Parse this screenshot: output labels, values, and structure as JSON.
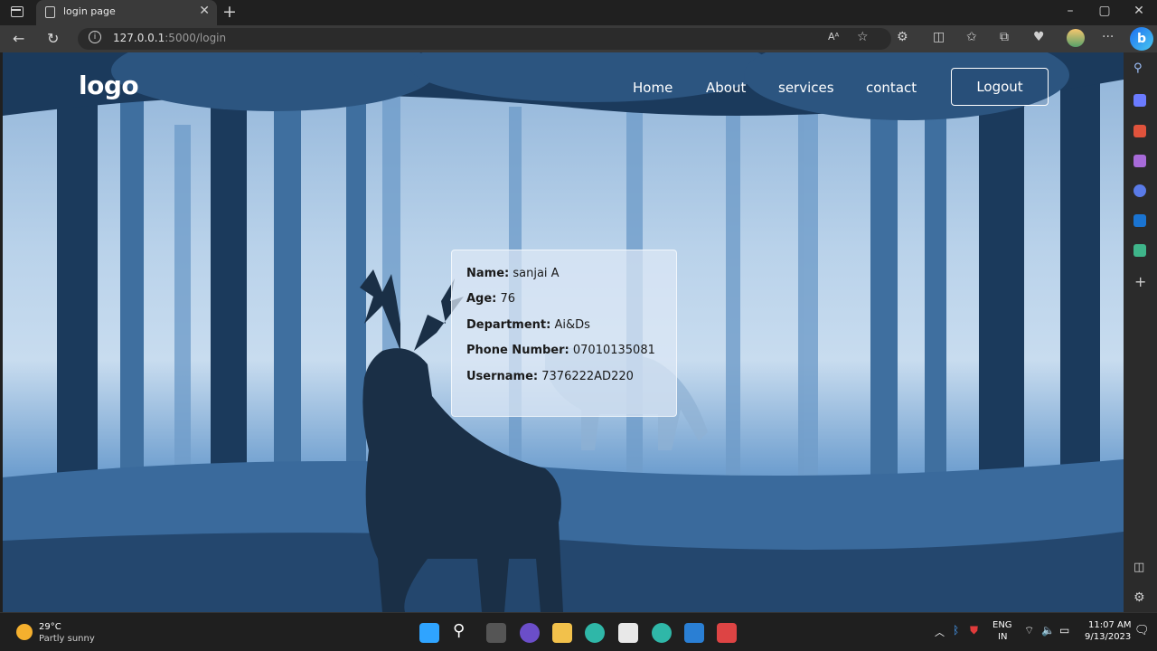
{
  "browser": {
    "tab_title": "login page",
    "url_host": "127.0.0.1",
    "url_path": ":5000/login",
    "icons": [
      "tab-actions-icon",
      "close-icon",
      "new-tab-icon",
      "minimize-icon",
      "maximize-icon",
      "close-window-icon",
      "back-icon",
      "refresh-icon",
      "info-icon",
      "read-aloud-icon",
      "favorite-icon",
      "extensions-icon",
      "split-screen-icon",
      "favorites-icon",
      "collections-icon",
      "health-icon",
      "profile-icon",
      "more-icon",
      "bing-icon"
    ]
  },
  "site": {
    "logo": "logo",
    "nav": [
      "Home",
      "About",
      "services",
      "contact"
    ],
    "logout_label": "Logout"
  },
  "profile": {
    "name_label": "Name:",
    "name_value": "sanjai A",
    "age_label": "Age:",
    "age_value": "76",
    "dept_label": "Department:",
    "dept_value": "Ai&Ds",
    "phone_label": "Phone Number:",
    "phone_value": "07010135081",
    "username_label": "Username:",
    "username_value": "7376222AD220"
  },
  "taskbar": {
    "weather_temp": "29°C",
    "weather_desc": "Partly sunny",
    "lang_top": "ENG",
    "lang_bottom": "IN",
    "time": "11:07 AM",
    "date": "9/13/2023"
  },
  "colors": {
    "accent": "#1d6ff2",
    "sky": "#c8dcef",
    "tree_dark": "#1b3a5c"
  }
}
